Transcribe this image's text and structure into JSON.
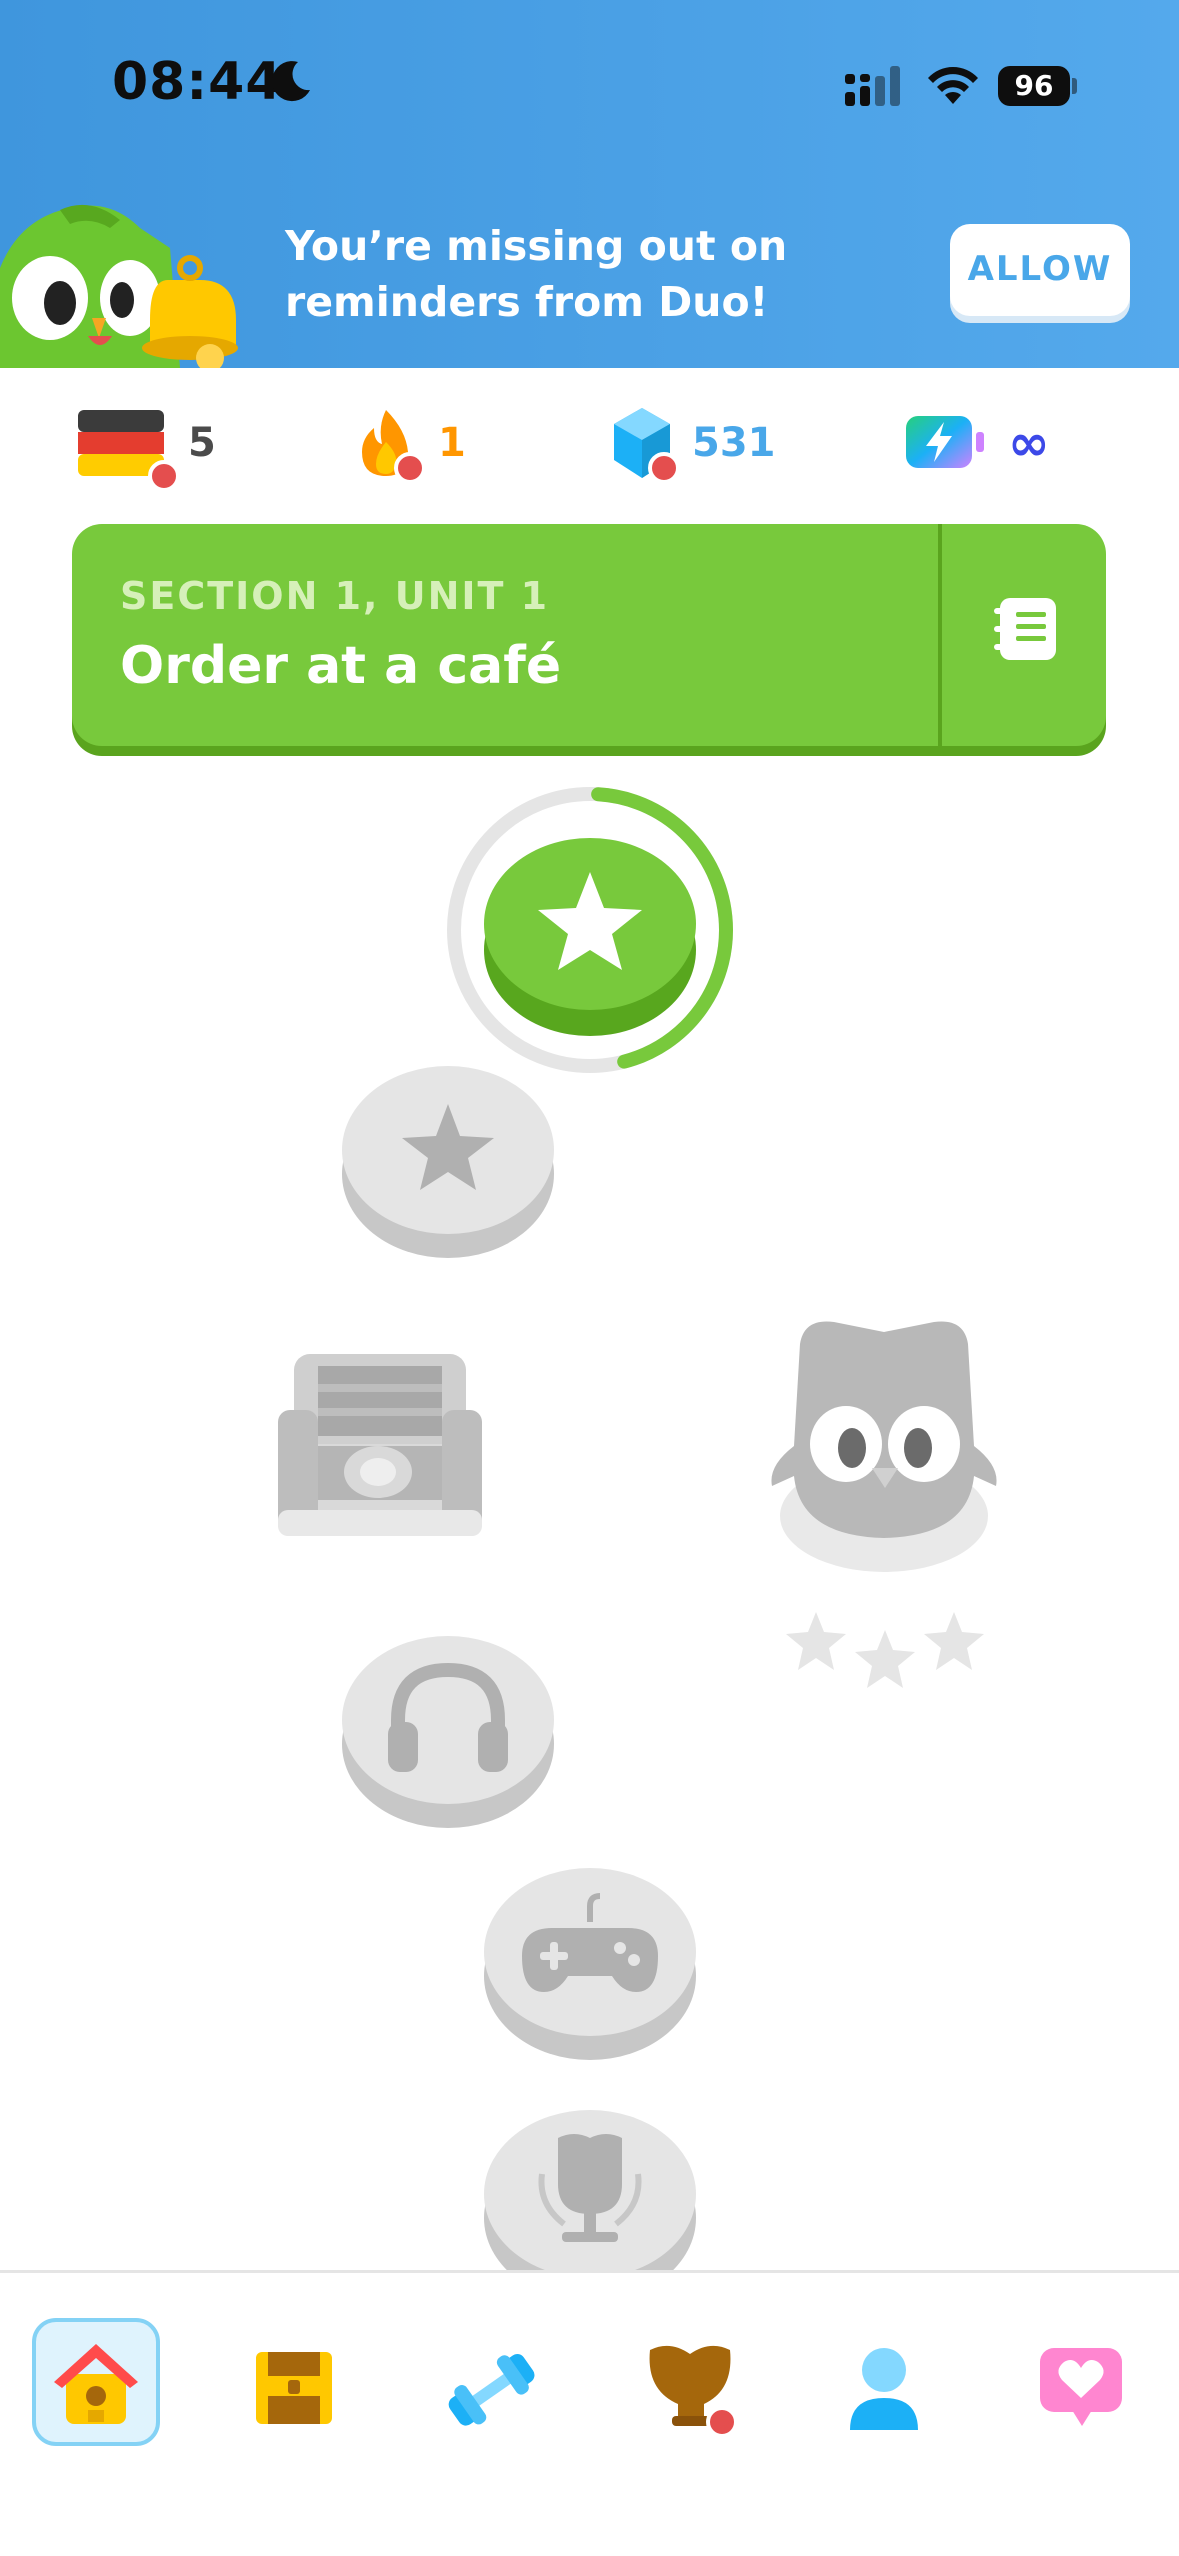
{
  "status_bar": {
    "time": "08:44",
    "battery": "96"
  },
  "banner": {
    "message": "You’re missing out on reminders from Duo!",
    "allow_label": "ALLOW"
  },
  "stats": {
    "language_count": "5",
    "streak": "1",
    "gems": "531",
    "energy": "∞"
  },
  "section": {
    "subtitle": "SECTION 1, UNIT 1",
    "title": "Order at a café"
  },
  "colors": {
    "accent_green": "#78c93c",
    "streak_orange": "#ff9600",
    "gems_blue": "#49a7e9",
    "energy_indigo": "#3c49e8"
  },
  "path": {
    "nodes": [
      "star-active",
      "star-locked",
      "chest-locked",
      "headphones-locked",
      "controller-locked",
      "trophy-locked"
    ],
    "progress": 0.45
  },
  "nav": {
    "items": [
      "home-icon",
      "treasure-icon",
      "practice-icon",
      "leaderboard-icon",
      "profile-icon",
      "heart-icon"
    ]
  }
}
